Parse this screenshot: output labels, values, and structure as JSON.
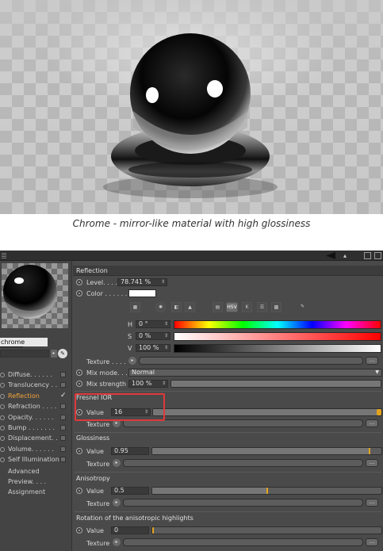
{
  "caption": "Chrome - mirror-like material with high glossiness",
  "material": {
    "name": "chrome",
    "channels": [
      {
        "label": "Diffuse. . . . . .",
        "checked": false,
        "active": false
      },
      {
        "label": "Translucency . .",
        "checked": false,
        "active": false
      },
      {
        "label": "Reflection",
        "checked": true,
        "active": true
      },
      {
        "label": "Refraction . . . .",
        "checked": false,
        "active": false
      },
      {
        "label": "Opacity. . . . . .",
        "checked": false,
        "active": false
      },
      {
        "label": "Bump . . . . . . .",
        "checked": false,
        "active": false
      },
      {
        "label": "Displacement. . .",
        "checked": false,
        "active": false
      },
      {
        "label": "Volume. . . . . .",
        "checked": false,
        "active": false
      },
      {
        "label": "Self Illumination",
        "checked": false,
        "active": false
      }
    ],
    "extras": [
      "Advanced",
      "Preview. . . .",
      "Assignment"
    ]
  },
  "reflection": {
    "title": "Reflection",
    "level_label": "Level. . . . . . .",
    "level_value": "78.741 %",
    "color_label": "Color . . . . . .",
    "color_hex": "#ffffff",
    "h_label": "H",
    "h_value": "0 °",
    "s_label": "S",
    "s_value": "0 %",
    "v_label": "V",
    "v_value": "100 %",
    "mode_icon_hsv": "HSV",
    "mode_icon_k": "K",
    "texture_label": "Texture . . . .",
    "mix_mode_label": "Mix mode. . . .",
    "mix_mode_value": "Normal",
    "mix_strength_label": "Mix strength",
    "mix_strength_value": "100 %"
  },
  "fresnel": {
    "title": "Fresnel IOR",
    "value_label": "Value",
    "value": "16",
    "level": 1.0,
    "texture_label": "Texture"
  },
  "glossiness": {
    "title": "Glossiness",
    "value_label": "Value",
    "value": "0.95",
    "level": 0.95,
    "texture_label": "Texture"
  },
  "anisotropy": {
    "title": "Anisotropy",
    "value_label": "Value",
    "value": "0.5",
    "level": 0.5,
    "texture_label": "Texture"
  },
  "rotation": {
    "title": "Rotation of the anisotropic highlights",
    "value_label": "Value",
    "value": "0",
    "level": 0.0,
    "texture_label": "Texture"
  },
  "buttons": {
    "dots": "..."
  },
  "colors": {
    "accent": "#f3a43a",
    "knob": "#e3a31f",
    "highlight": "#e0383b",
    "panel_bg": "#4a4a4a"
  }
}
